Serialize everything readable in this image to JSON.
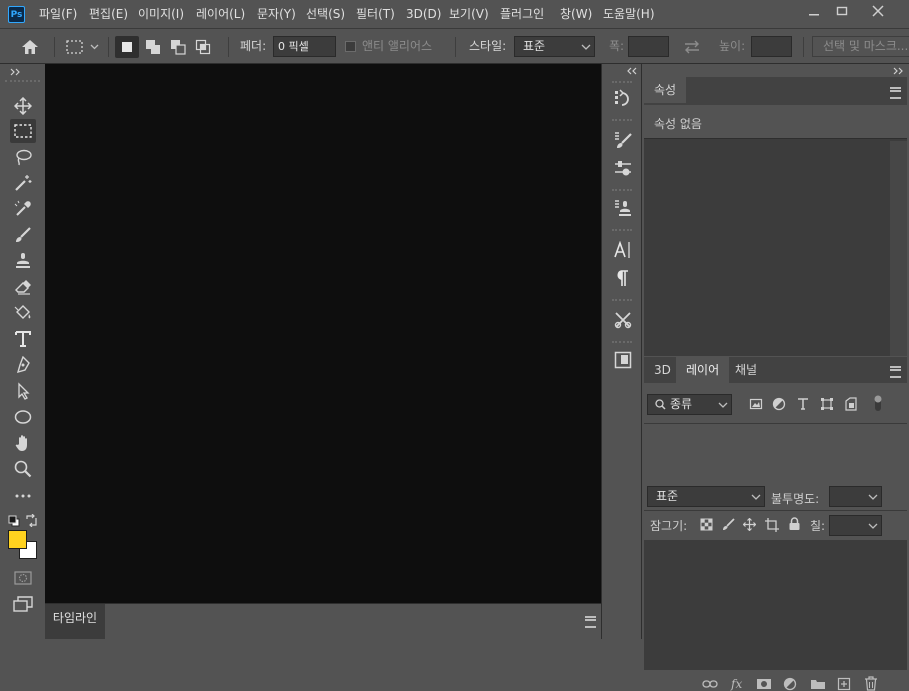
{
  "app": {
    "logo": "Ps"
  },
  "menu": [
    "파일(F)",
    "편집(E)",
    "이미지(I)",
    "레이어(L)",
    "문자(Y)",
    "선택(S)",
    "필터(T)",
    "3D(D)",
    "보기(V)",
    "플러그인",
    "창(W)",
    "도움말(H)"
  ],
  "options": {
    "feather_label": "페더:",
    "feather_value": "0 픽셀",
    "antialias_label": "앤티 앨리어스",
    "style_label": "스타일:",
    "style_value": "표준",
    "width_label": "폭:",
    "height_label": "높이:",
    "select_mask_label": "선택 및 마스크..."
  },
  "colors": {
    "foreground": "#ffd21f",
    "background": "#ffffff"
  },
  "timeline": {
    "tab": "타임라인"
  },
  "properties": {
    "tab": "속성",
    "empty_text": "속성 없음"
  },
  "layers_panel": {
    "tabs": [
      "3D",
      "레이어",
      "채널"
    ],
    "active_tab": "레이어",
    "filter_kind": "종류",
    "blend_mode": "표준",
    "opacity_label": "불투명도:",
    "lock_label": "잠그기:",
    "fill_label": "칠:"
  },
  "icons": {
    "toolbar": [
      "move-icon",
      "rect-marquee-icon",
      "lasso-icon",
      "magic-wand-icon",
      "eyedropper-icon",
      "brush-icon",
      "stamp-icon",
      "eraser-icon",
      "paint-bucket-icon",
      "type-icon",
      "pen-icon",
      "path-select-icon",
      "ellipse-icon",
      "hand-icon",
      "zoom-icon",
      "more-icon"
    ],
    "strip": [
      "history-icon",
      "brush-settings-icon",
      "adjustments-icon",
      "clone-source-icon",
      "character-icon",
      "paragraph-icon",
      "tool-presets-icon",
      "glyphs-icon"
    ]
  }
}
